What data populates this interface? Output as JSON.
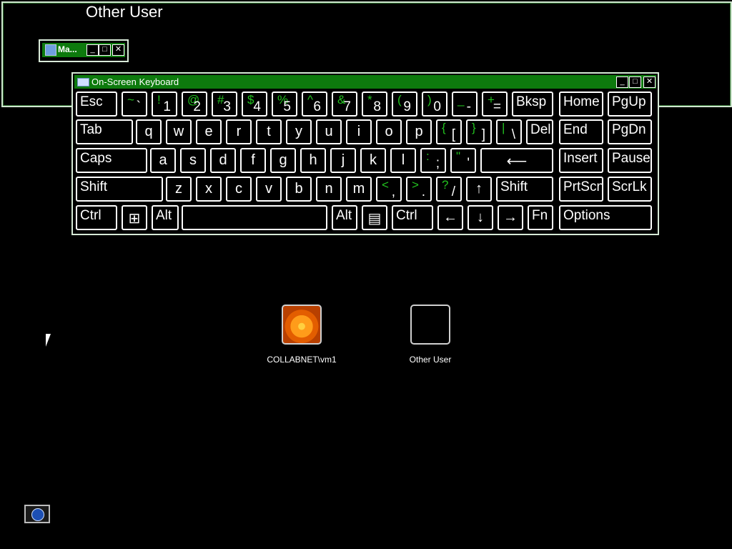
{
  "background_window": {
    "title": "Other User"
  },
  "magnifier_window": {
    "title": "Ma..."
  },
  "osk": {
    "title": "On-Screen Keyboard",
    "rows": [
      [
        {
          "id": "esc",
          "label": "Esc"
        },
        {
          "id": "tilde",
          "sym": "~",
          "num": "`"
        },
        {
          "id": "1",
          "sym": "!",
          "num": "1"
        },
        {
          "id": "2",
          "sym": "@",
          "num": "2"
        },
        {
          "id": "3",
          "sym": "#",
          "num": "3"
        },
        {
          "id": "4",
          "sym": "$",
          "num": "4"
        },
        {
          "id": "5",
          "sym": "%",
          "num": "5"
        },
        {
          "id": "6",
          "sym": "^",
          "num": "6"
        },
        {
          "id": "7",
          "sym": "&",
          "num": "7"
        },
        {
          "id": "8",
          "sym": "*",
          "num": "8"
        },
        {
          "id": "9",
          "sym": "(",
          "num": "9"
        },
        {
          "id": "0",
          "sym": ")",
          "num": "0"
        },
        {
          "id": "minus",
          "sym": "_",
          "num": "-"
        },
        {
          "id": "plus",
          "sym": "+",
          "num": "="
        },
        {
          "id": "bksp",
          "label": "Bksp"
        },
        {
          "id": "home",
          "label": "Home"
        },
        {
          "id": "pgup",
          "label": "PgUp"
        }
      ],
      [
        {
          "id": "tab",
          "label": "Tab"
        },
        {
          "id": "q",
          "label": "q"
        },
        {
          "id": "w",
          "label": "w"
        },
        {
          "id": "e",
          "label": "e"
        },
        {
          "id": "r",
          "label": "r"
        },
        {
          "id": "t",
          "label": "t"
        },
        {
          "id": "y",
          "label": "y"
        },
        {
          "id": "u",
          "label": "u"
        },
        {
          "id": "i",
          "label": "i"
        },
        {
          "id": "o",
          "label": "o"
        },
        {
          "id": "p",
          "label": "p"
        },
        {
          "id": "lbrace",
          "sym": "{",
          "num": "["
        },
        {
          "id": "rbrace",
          "sym": "}",
          "num": "]"
        },
        {
          "id": "pipe",
          "sym": "|",
          "num": "\\"
        },
        {
          "id": "del",
          "label": "Del"
        },
        {
          "id": "end",
          "label": "End"
        },
        {
          "id": "pgdn",
          "label": "PgDn"
        }
      ],
      [
        {
          "id": "caps",
          "label": "Caps"
        },
        {
          "id": "a",
          "label": "a"
        },
        {
          "id": "s",
          "label": "s"
        },
        {
          "id": "d",
          "label": "d"
        },
        {
          "id": "f",
          "label": "f"
        },
        {
          "id": "g",
          "label": "g"
        },
        {
          "id": "h",
          "label": "h"
        },
        {
          "id": "j",
          "label": "j"
        },
        {
          "id": "k",
          "label": "k"
        },
        {
          "id": "l",
          "label": "l"
        },
        {
          "id": "colon",
          "sym": ":",
          "num": ";"
        },
        {
          "id": "quote",
          "sym": "\"",
          "num": "'"
        },
        {
          "id": "enter",
          "label": "⟵"
        },
        {
          "id": "insert",
          "label": "Insert"
        },
        {
          "id": "pause",
          "label": "Pause"
        }
      ],
      [
        {
          "id": "lshift",
          "label": "Shift"
        },
        {
          "id": "z",
          "label": "z"
        },
        {
          "id": "x",
          "label": "x"
        },
        {
          "id": "c",
          "label": "c"
        },
        {
          "id": "v",
          "label": "v"
        },
        {
          "id": "b",
          "label": "b"
        },
        {
          "id": "n",
          "label": "n"
        },
        {
          "id": "m",
          "label": "m"
        },
        {
          "id": "comma",
          "sym": "<",
          "num": ","
        },
        {
          "id": "period",
          "sym": ">",
          "num": "."
        },
        {
          "id": "slash",
          "sym": "?",
          "num": "/"
        },
        {
          "id": "up",
          "label": "↑"
        },
        {
          "id": "rshift",
          "label": "Shift"
        },
        {
          "id": "prtscn",
          "label": "PrtScn"
        },
        {
          "id": "scrlk",
          "label": "ScrLk"
        }
      ],
      [
        {
          "id": "lctrl",
          "label": "Ctrl"
        },
        {
          "id": "win",
          "label": "⊞"
        },
        {
          "id": "lalt",
          "label": "Alt"
        },
        {
          "id": "space",
          "label": ""
        },
        {
          "id": "ralt",
          "label": "Alt"
        },
        {
          "id": "menu",
          "label": "▤"
        },
        {
          "id": "rctrl",
          "label": "Ctrl"
        },
        {
          "id": "left",
          "label": "←"
        },
        {
          "id": "down",
          "label": "↓"
        },
        {
          "id": "right",
          "label": "→"
        },
        {
          "id": "fn",
          "label": "Fn"
        },
        {
          "id": "options",
          "label": "Options"
        }
      ]
    ]
  },
  "users": [
    {
      "name": "COLLABNET\\vm1"
    },
    {
      "name": "Other User"
    }
  ],
  "colors": {
    "title_bar": "#0d7a0d",
    "symbol": "#22c21f",
    "key_border": "#ffffff",
    "background": "#000000"
  }
}
